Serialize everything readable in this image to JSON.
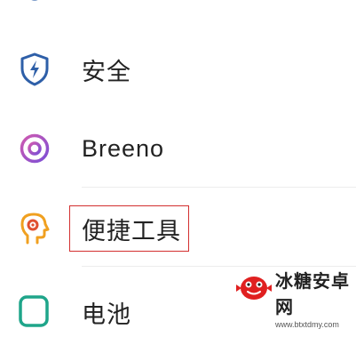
{
  "settings_list": {
    "items": [
      {
        "label": "",
        "icon": "partial-top-icon"
      },
      {
        "label": "安全",
        "icon": "shield-bolt-icon",
        "color": "#2e5fa8"
      },
      {
        "label": "Breeno",
        "icon": "breeno-ring-icon",
        "color": "#8a4fd0"
      },
      {
        "label": "便捷工具",
        "icon": "head-tool-icon",
        "color": "#f0a020"
      },
      {
        "label": "电池",
        "icon": "battery-icon",
        "color": "#1fa58a"
      }
    ]
  },
  "highlight_color": "#d32f2f",
  "watermark": {
    "title": "冰糖安卓网",
    "url": "www.btxtdmy.com"
  }
}
